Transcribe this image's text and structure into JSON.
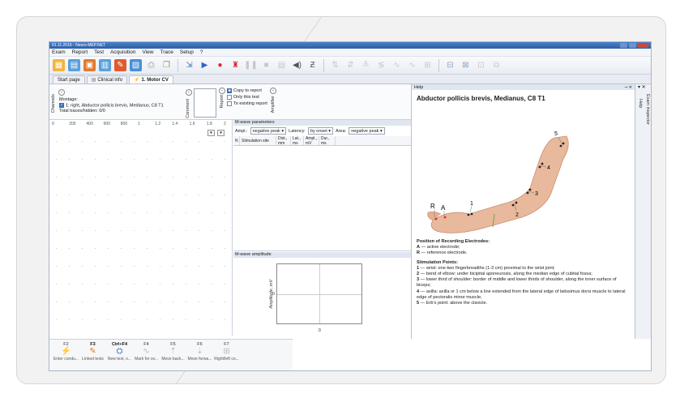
{
  "window": {
    "title": "01.11.2016 - Neuro-MEP.NET"
  },
  "menu": [
    "Exam",
    "Report",
    "Test",
    "Acquisition",
    "View",
    "Trace",
    "Setup",
    "?"
  ],
  "toolbar_icons": [
    "patient-card-icon",
    "exam-list-icon",
    "exam-open-icon",
    "report-icon",
    "report-edit-icon",
    "template-icon",
    "print-icon",
    "copy-icon",
    "export-icon",
    "play-icon",
    "record-icon",
    "stimulator-icon",
    "pause-icon",
    "stop-icon",
    "screenshot-icon",
    "speaker-icon",
    "filter-icon",
    "marker-a-icon",
    "marker-b-icon",
    "marker-c-icon",
    "marker-d-icon",
    "marker-e-icon",
    "marker-f-icon",
    "grid-icon",
    "split-icon",
    "lock-icon",
    "layout-icon",
    "window-icon"
  ],
  "tabs": [
    {
      "label": "Start page"
    },
    {
      "label": "Clinical info"
    },
    {
      "label": "1. Motor CV"
    }
  ],
  "montage": {
    "channels_label": "Channels",
    "montage_label": "Montage:",
    "item": "1: right, Abductor pollicis brevis, Medianus, C8 T1",
    "total": "Total traces/hidden: 0/0",
    "comment_label": "Comment",
    "report_label": "Report",
    "copy_to_report": "Copy to report",
    "only_this_test": "Only this test",
    "to_existing_report": "To existing report",
    "amplifier_label": "Amplifier"
  },
  "plot": {
    "ticks": [
      "0",
      "200",
      "400",
      "600",
      "800",
      "1",
      "1.2",
      "1.4",
      "1.6",
      "1.8",
      "2"
    ]
  },
  "mwave_params": {
    "title": "M-wave parameters",
    "ampl_label": "Ampl.:",
    "ampl_value": "negative peak",
    "latency_label": "Latency:",
    "latency_value": "by onset",
    "area_label": "Area:",
    "area_value": "negative peak",
    "columns": [
      "N",
      "Stimulation site",
      "Dist., mm",
      "Lat., ms",
      "Ampl., mV",
      "Dur., ms"
    ]
  },
  "mwave_ampl": {
    "title": "M-wave amplitude",
    "ylabel": "Amplitude, mV",
    "y_tick": "0",
    "x_tick": "0"
  },
  "help": {
    "pane_label": "Help",
    "title": "Abductor pollicis brevis, Medianus, C8 T1",
    "arm_labels": {
      "r": "R",
      "a": "A",
      "n1": "1",
      "n2": "2",
      "n3": "3",
      "n4": "4",
      "n5": "5"
    },
    "rec_title": "Position of Recording Electrodes:",
    "rec_a": "A",
    "rec_a_text": " — active electrode;",
    "rec_r": "R",
    "rec_r_text": " — reference electrode.",
    "stim_title": "Stimulation Points:",
    "stim": [
      {
        "n": "1",
        "t": " — wrist: one-two fingerbreadths (1-3 cm) proximal to the wrist joint;"
      },
      {
        "n": "2",
        "t": " — bend of elbow: under bicipital aponeurosis, along the median edge of cubital fossa;"
      },
      {
        "n": "3",
        "t": " — lower third of shoulder: border of middle and lower thirds of shoulder, along the inner surface of biceps;"
      },
      {
        "n": "4",
        "t": " — axilla: axilla or 1 cm below a line extended from the lateral edge of latissimus dorsi muscle to lateral edge of pectoralis minor muscle;"
      },
      {
        "n": "5",
        "t": " — Erb's point: above the clavicle."
      }
    ]
  },
  "inspector": {
    "label": "Exam inspector",
    "help_tab": "Help"
  },
  "fkeys": [
    {
      "key": "F2",
      "label": "Enter condu...",
      "icon": "conduction-icon",
      "bold": false
    },
    {
      "key": "F3",
      "label": "Linked tests",
      "icon": "link-icon",
      "bold": true
    },
    {
      "key": "Ctrl+F4",
      "label": "New test, o...",
      "icon": "new-test-icon",
      "bold": true
    },
    {
      "key": "F4",
      "label": "Mark for ov...",
      "icon": "mark-icon",
      "bold": false
    },
    {
      "key": "F5",
      "label": "Move back...",
      "icon": "move-back-icon",
      "bold": false
    },
    {
      "key": "F6",
      "label": "Move forwa...",
      "icon": "move-forward-icon",
      "bold": false
    },
    {
      "key": "F7",
      "label": "Right/left co...",
      "icon": "compare-icon",
      "bold": false
    }
  ]
}
